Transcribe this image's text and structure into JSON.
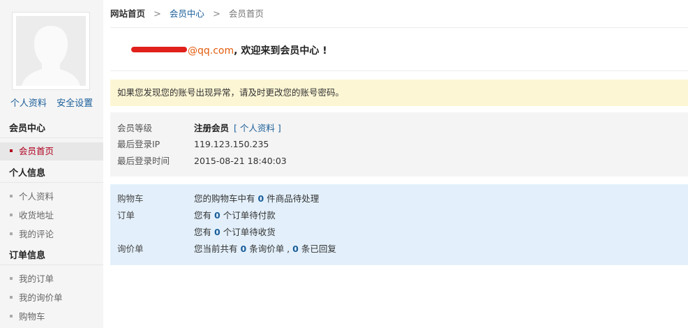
{
  "sidebar": {
    "profile_link": "个人资料",
    "security_link": "安全设置",
    "sections": [
      {
        "title": "会员中心",
        "items": [
          {
            "label": "会员首页",
            "active": true
          }
        ]
      },
      {
        "title": "个人信息",
        "items": [
          {
            "label": "个人资料"
          },
          {
            "label": "收货地址"
          },
          {
            "label": "我的评论"
          }
        ]
      },
      {
        "title": "订单信息",
        "items": [
          {
            "label": "我的订单"
          },
          {
            "label": "我的询价单"
          },
          {
            "label": "购物车"
          }
        ]
      }
    ]
  },
  "breadcrumb": {
    "home": "网站首页",
    "sep1": ">",
    "member_center": "会员中心",
    "sep2": ">",
    "current": "会员首页"
  },
  "welcome": {
    "email_suffix": "@qq.com",
    "message": ", 欢迎来到会员中心 !"
  },
  "notice": "如果您发现您的账号出现异常，请及时更改您的账号密码。",
  "account_info": {
    "level_label": "会员等级",
    "level_value": "注册会员",
    "profile_link": "[ 个人资料 ]",
    "ip_label": "最后登录IP",
    "ip_value": "119.123.150.235",
    "time_label": "最后登录时间",
    "time_value": "2015-08-21 18:40:03"
  },
  "summary": {
    "cart_label": "购物车",
    "cart_prefix": "您的购物车中有",
    "cart_count": "0",
    "cart_suffix": "件商品待处理",
    "order_label": "订单",
    "order_pay_prefix": "您有",
    "order_pay_count": "0",
    "order_pay_suffix": "个订单待付款",
    "order_recv_prefix": "您有",
    "order_recv_count": "0",
    "order_recv_suffix": "个订单待收货",
    "inquiry_label": "询价单",
    "inquiry_prefix": "您当前共有",
    "inquiry_count": "0",
    "inquiry_mid": "条询价单 ,",
    "inquiry_reply_count": "0",
    "inquiry_suffix": "条已回复"
  },
  "colors": {
    "link": "#1a5e9a",
    "active": "#b0001e",
    "email": "#e35b0d",
    "notice_bg": "#fdf6d4",
    "summary_bg": "#e3f0fb"
  }
}
